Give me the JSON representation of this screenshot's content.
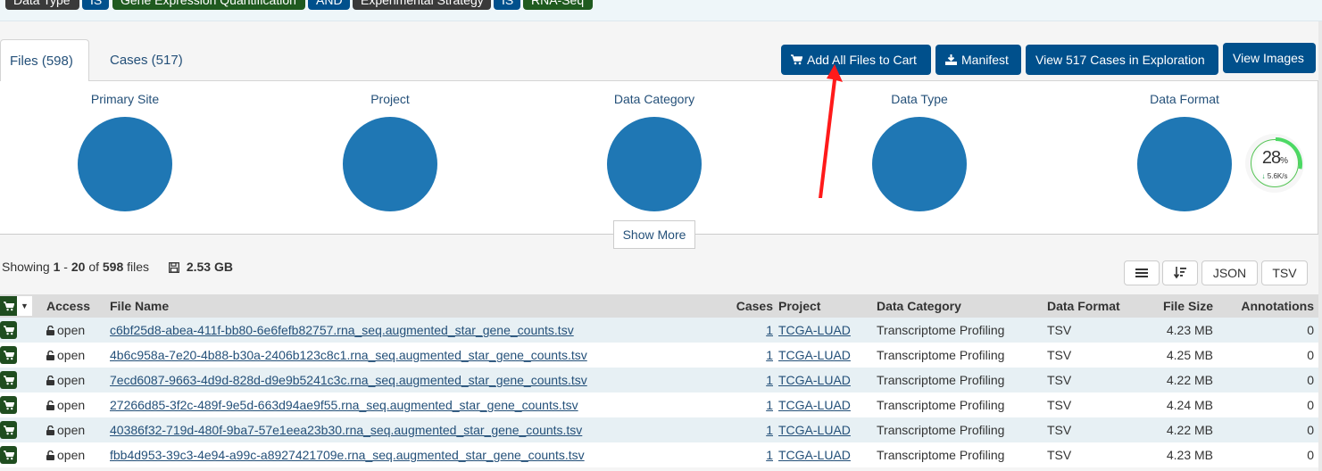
{
  "filter_bar": {
    "chips": [
      {
        "label": "Data Type",
        "style": "dark"
      },
      {
        "label": "IS",
        "style": "blue"
      },
      {
        "label": "Gene Expression Quantification",
        "style": "green"
      },
      {
        "label": "AND",
        "style": "blue"
      },
      {
        "label": "Experimental Strategy",
        "style": "dark"
      },
      {
        "label": "IS",
        "style": "blue"
      },
      {
        "label": "RNA-Seq",
        "style": "green"
      }
    ]
  },
  "tabs": [
    {
      "label": "Files (598)",
      "active": true
    },
    {
      "label": "Cases (517)",
      "active": false
    }
  ],
  "actions": {
    "add_all": "Add All Files to Cart",
    "manifest": "Manifest",
    "view_cases": "View 517 Cases in Exploration",
    "view_images": "View Images"
  },
  "facets": [
    "Primary Site",
    "Project",
    "Data Category",
    "Data Type",
    "Data Format"
  ],
  "pie_color": "#1f77b4",
  "speed_widget": {
    "percent": "28",
    "percent_unit": "%",
    "rate": "5.6K/s",
    "progress": 0.28
  },
  "show_more": "Show More",
  "summary": {
    "prefix": "Showing",
    "from": "1",
    "dash": "-",
    "to": "20",
    "of": "of",
    "total": "598",
    "suffix": "files",
    "size": "2.53 GB"
  },
  "table_tools": {
    "json": "JSON",
    "tsv": "TSV"
  },
  "table": {
    "headers": {
      "access": "Access",
      "file_name": "File Name",
      "cases": "Cases",
      "project": "Project",
      "data_category": "Data Category",
      "data_format": "Data Format",
      "file_size": "File Size",
      "annotations": "Annotations"
    },
    "rows": [
      {
        "access": "open",
        "file_name": "c6bf25d8-abea-411f-bb80-6e6fefb82757.rna_seq.augmented_star_gene_counts.tsv",
        "cases": "1",
        "project": "TCGA-LUAD",
        "data_category": "Transcriptome Profiling",
        "data_format": "TSV",
        "file_size": "4.23 MB",
        "annotations": "0"
      },
      {
        "access": "open",
        "file_name": "4b6c958a-7e20-4b88-b30a-2406b123c8c1.rna_seq.augmented_star_gene_counts.tsv",
        "cases": "1",
        "project": "TCGA-LUAD",
        "data_category": "Transcriptome Profiling",
        "data_format": "TSV",
        "file_size": "4.25 MB",
        "annotations": "0"
      },
      {
        "access": "open",
        "file_name": "7ecd6087-9663-4d9d-828d-d9e9b5241c3c.rna_seq.augmented_star_gene_counts.tsv",
        "cases": "1",
        "project": "TCGA-LUAD",
        "data_category": "Transcriptome Profiling",
        "data_format": "TSV",
        "file_size": "4.22 MB",
        "annotations": "0"
      },
      {
        "access": "open",
        "file_name": "27266d85-3f2c-489f-9e5d-663d94ae9f55.rna_seq.augmented_star_gene_counts.tsv",
        "cases": "1",
        "project": "TCGA-LUAD",
        "data_category": "Transcriptome Profiling",
        "data_format": "TSV",
        "file_size": "4.24 MB",
        "annotations": "0"
      },
      {
        "access": "open",
        "file_name": "40386f32-719d-480f-9ba7-57e1eea23b30.rna_seq.augmented_star_gene_counts.tsv",
        "cases": "1",
        "project": "TCGA-LUAD",
        "data_category": "Transcriptome Profiling",
        "data_format": "TSV",
        "file_size": "4.22 MB",
        "annotations": "0"
      },
      {
        "access": "open",
        "file_name": "fbb4d953-39c3-4e94-a99c-a8927421709e.rna_seq.augmented_star_gene_counts.tsv",
        "cases": "1",
        "project": "TCGA-LUAD",
        "data_category": "Transcriptome Profiling",
        "data_format": "TSV",
        "file_size": "4.23 MB",
        "annotations": "0"
      }
    ]
  },
  "annotation_arrow_color": "#ff1a1a"
}
